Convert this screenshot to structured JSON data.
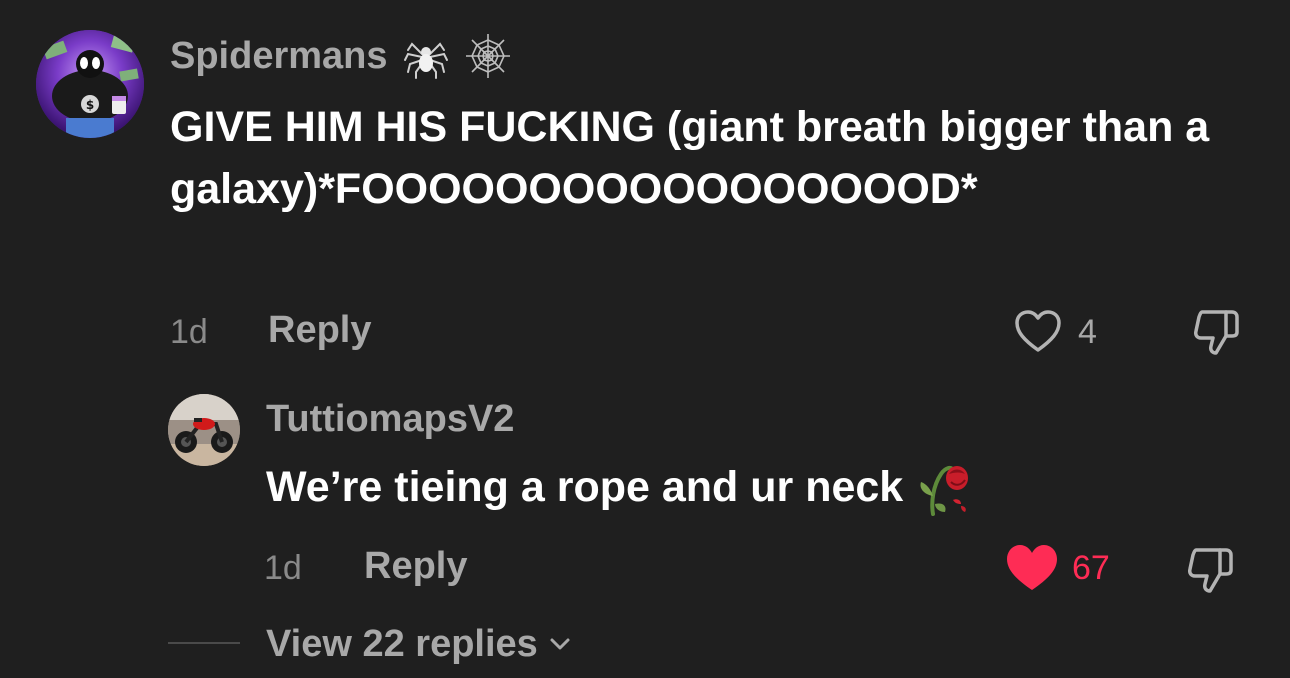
{
  "comment": {
    "username": "Spidermans",
    "badges": [
      "spider-icon",
      "spiderweb-icon"
    ],
    "text": "GIVE HIM HIS FUCKING (giant breath bigger than a galaxy)*FOOOOOOOOOOOOOOOOOD*",
    "time": "1d",
    "reply_label": "Reply",
    "like_count": "4",
    "liked": false
  },
  "reply": {
    "username": "TuttiomapsV2",
    "text": "We’re tieing a rope and ur neck",
    "emoji": "wilted-rose-icon",
    "time": "1d",
    "reply_label": "Reply",
    "like_count": "67",
    "liked": true
  },
  "view_replies_label": "View 22 replies",
  "colors": {
    "background": "#1f1f1f",
    "text_primary": "#ffffff",
    "text_secondary": "#a8a8a8",
    "like_active": "#fe2c55"
  }
}
